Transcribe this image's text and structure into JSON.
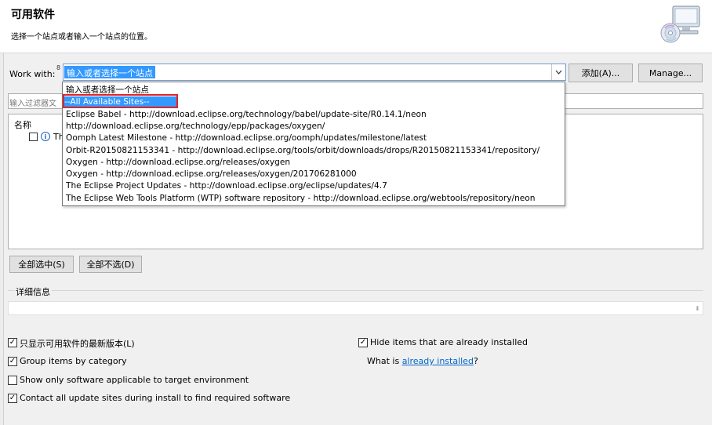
{
  "banner": {
    "title": "可用软件",
    "description": "选择一个站点或者输入一个站点的位置。",
    "icon": "software-cd-icon"
  },
  "work_with": {
    "label": "Work with:",
    "badge": "8",
    "value": "输入或者选择一个站点",
    "add_button": "添加(A)...",
    "manage_button": "Manage..."
  },
  "dropdown": {
    "items": [
      "输入或者选择一个站点",
      "--All Available Sites--",
      "Eclipse Babel - http://download.eclipse.org/technology/babel/update-site/R0.14.1/neon",
      "http://download.eclipse.org/technology/epp/packages/oxygen/",
      "Oomph Latest Milestone - http://download.eclipse.org/oomph/updates/milestone/latest",
      "Orbit-R20150821153341 - http://download.eclipse.org/tools/orbit/downloads/drops/R20150821153341/repository/",
      "Oxygen - http://download.eclipse.org/releases/oxygen",
      "Oxygen - http://download.eclipse.org/releases/oxygen/201706281000",
      "The Eclipse Project Updates - http://download.eclipse.org/eclipse/updates/4.7",
      "The Eclipse Web Tools Platform (WTP) software repository - http://download.eclipse.org/webtools/repository/neon"
    ],
    "selected_index": 1,
    "highlight_color": "#e02424"
  },
  "filter": {
    "placeholder": "输入过滤器文"
  },
  "tree": {
    "column_header": "名称",
    "row_text": "Th"
  },
  "buttons": {
    "select_all": "全部选中(S)",
    "deselect_all": "全部不选(D)"
  },
  "details": {
    "label": "详细信息"
  },
  "options": {
    "show_latest": {
      "label": "只显示可用软件的最新版本(L)",
      "checked": true
    },
    "hide_installed": {
      "label": "Hide items that are already installed",
      "checked": true
    },
    "group_by_category": {
      "label": "Group items by category",
      "checked": true
    },
    "what_is_prefix": "What is ",
    "what_is_link": "already installed",
    "what_is_suffix": "?",
    "show_applicable": {
      "label": "Show only software applicable to target environment",
      "checked": false
    },
    "contact_all": {
      "label": "Contact all update sites during install to find required software",
      "checked": true
    }
  },
  "colors": {
    "selection": "#3399ff",
    "link": "#0066cc"
  }
}
